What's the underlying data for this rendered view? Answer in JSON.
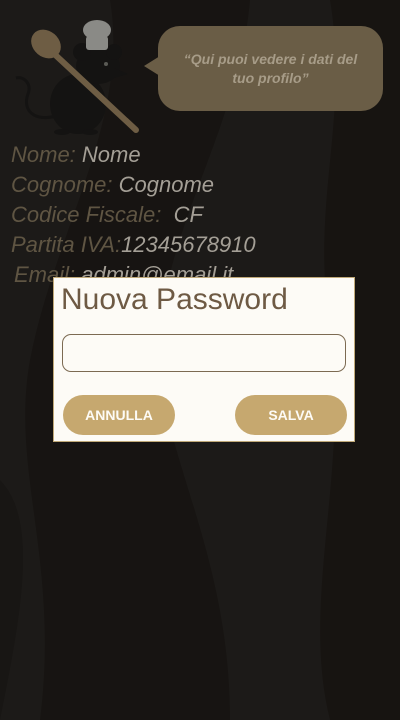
{
  "header": {
    "mascot_icon": "chef-rat-with-spoon-icon",
    "speech_text": "“Qui puoi vedere i dati del tuo profilo”"
  },
  "profile": {
    "nome_label": "Nome:",
    "nome_value": "Nome",
    "cognome_label": "Cognome:",
    "cognome_value": "Cognome",
    "cf_label": "Codice Fiscale:",
    "cf_value": "CF",
    "piva_label": "Partita IVA:",
    "piva_value": "12345678910",
    "email_label": "Email:",
    "email_value": "admin@email.it"
  },
  "dialog": {
    "title": "Nuova Password",
    "input_value": "",
    "cancel_label": "ANNULLA",
    "save_label": "SALVA"
  },
  "colors": {
    "accent": "#c6a86f",
    "bubble": "#6a5d46",
    "dialog_bg": "#fdfbf6",
    "title_text": "#6e5a44"
  }
}
